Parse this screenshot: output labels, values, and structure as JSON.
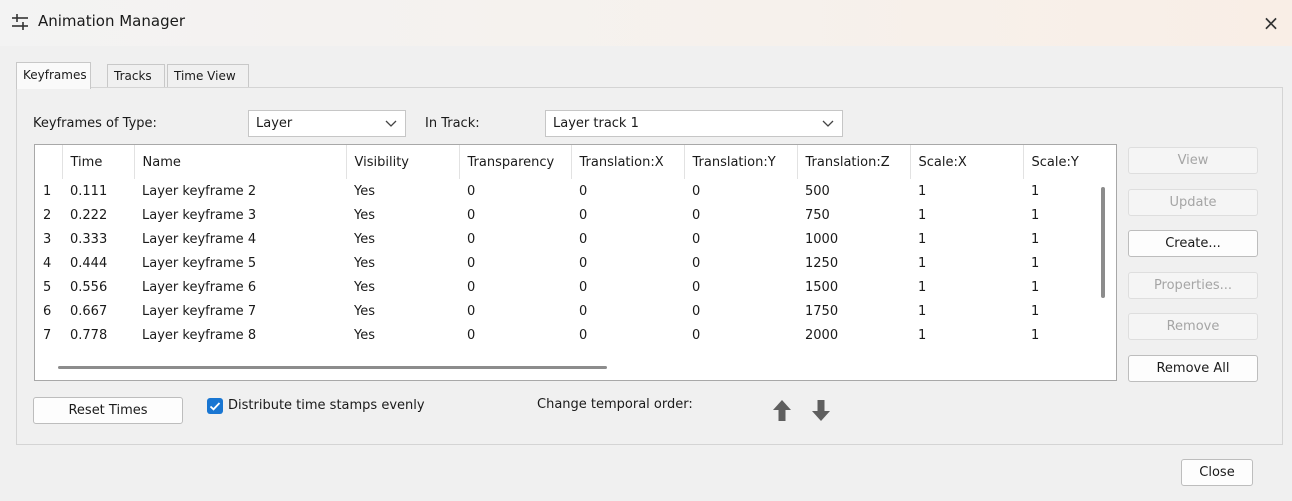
{
  "window": {
    "title": "Animation Manager",
    "close_glyph": "×",
    "icon": "sliders-icon"
  },
  "tabs": [
    {
      "label": "Keyframes",
      "active": true
    },
    {
      "label": "Tracks",
      "active": false
    },
    {
      "label": "Time View",
      "active": false
    }
  ],
  "filters": {
    "type_label": "Keyframes of Type:",
    "type_value": "Layer",
    "track_label": "In Track:",
    "track_value": "Layer track 1"
  },
  "table": {
    "columns": [
      "",
      "Time",
      "Name",
      "Visibility",
      "Transparency",
      "Translation:X",
      "Translation:Y",
      "Translation:Z",
      "Scale:X",
      "Scale:Y"
    ],
    "rows": [
      [
        "1",
        "0.111",
        "Layer keyframe 2",
        "Yes",
        "0",
        "0",
        "0",
        "500",
        "1",
        "1"
      ],
      [
        "2",
        "0.222",
        "Layer keyframe 3",
        "Yes",
        "0",
        "0",
        "0",
        "750",
        "1",
        "1"
      ],
      [
        "3",
        "0.333",
        "Layer keyframe 4",
        "Yes",
        "0",
        "0",
        "0",
        "1000",
        "1",
        "1"
      ],
      [
        "4",
        "0.444",
        "Layer keyframe 5",
        "Yes",
        "0",
        "0",
        "0",
        "1250",
        "1",
        "1"
      ],
      [
        "5",
        "0.556",
        "Layer keyframe 6",
        "Yes",
        "0",
        "0",
        "0",
        "1500",
        "1",
        "1"
      ],
      [
        "6",
        "0.667",
        "Layer keyframe 7",
        "Yes",
        "0",
        "0",
        "0",
        "1750",
        "1",
        "1"
      ],
      [
        "7",
        "0.778",
        "Layer keyframe 8",
        "Yes",
        "0",
        "0",
        "0",
        "2000",
        "1",
        "1"
      ]
    ]
  },
  "side_buttons": {
    "view": "View",
    "update": "Update",
    "create": "Create...",
    "properties": "Properties...",
    "remove": "Remove",
    "remove_all": "Remove All"
  },
  "bottom": {
    "reset_times": "Reset Times",
    "distribute_label": "Distribute time stamps evenly",
    "distribute_checked": true,
    "temporal_order_label": "Change temporal order:"
  },
  "footer": {
    "close": "Close"
  },
  "colors": {
    "accent": "#1976d2",
    "arrow": "#5f5f5f",
    "disabled_text": "#a5a5a5"
  }
}
